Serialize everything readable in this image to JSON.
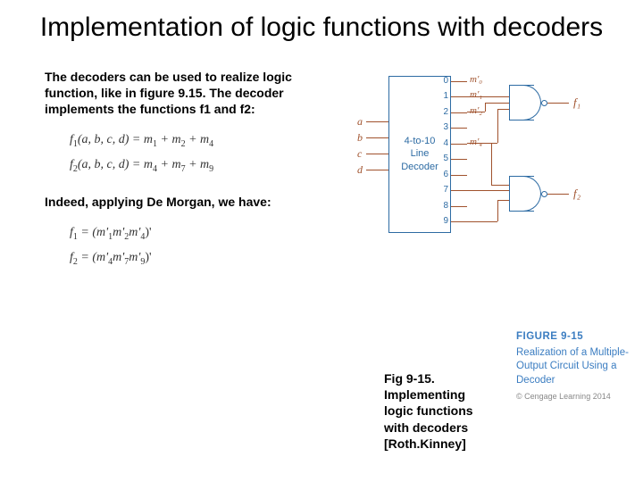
{
  "title": "Implementation of logic functions with decoders",
  "para1": "The decoders can be used to realize logic function, like in figure 9.15. The decoder implements the functions f1 and f2:",
  "eq1_lhs": "f",
  "eq1_sub": "1",
  "eq1_args": "(a, b, c, d) = m",
  "eq1_m1": "1",
  "eq1_plus1": " + m",
  "eq1_m2": "2",
  "eq1_plus2": " + m",
  "eq1_m3": "4",
  "eq2_lhs": "f",
  "eq2_sub": "2",
  "eq2_args": "(a, b, c, d) = m",
  "eq2_m1": "4",
  "eq2_plus1": " + m",
  "eq2_m2": "7",
  "eq2_plus2": " + m",
  "eq2_m3": "9",
  "para2": "Indeed, applying De Morgan, we have:",
  "eq3_lhs": "f",
  "eq3_sub": "1",
  "eq3_eq": " = (m'",
  "eq3_a": "1",
  "eq3_b_pre": "m'",
  "eq3_b": "2",
  "eq3_c_pre": "m'",
  "eq3_c": "4",
  "eq3_end": ")'",
  "eq4_lhs": "f",
  "eq4_sub": "2",
  "eq4_eq": " = (m'",
  "eq4_a": "4",
  "eq4_b_pre": "m'",
  "eq4_b": "7",
  "eq4_c_pre": "m'",
  "eq4_c": "9",
  "eq4_end": ")'",
  "decoder": {
    "label": "4-to-10\nLine\nDecoder",
    "inputs": [
      "a",
      "b",
      "c",
      "d"
    ],
    "outputs": [
      "0",
      "1",
      "2",
      "3",
      "4",
      "5",
      "6",
      "7",
      "8",
      "9"
    ],
    "minterms": [
      "m'₀",
      "m'₁",
      "m'₂",
      "",
      "m'₄",
      "",
      "",
      "",
      "",
      ""
    ],
    "f1": "f₁",
    "f2": "f₂"
  },
  "fig_right": {
    "num": "FIGURE 9-15",
    "txt": "Realization of a Multiple-Output Circuit Using a Decoder",
    "copy": "© Cengage Learning 2014"
  },
  "fig_left": "Fig 9-15. Implementing logic functions with decoders [Roth.Kinney]"
}
